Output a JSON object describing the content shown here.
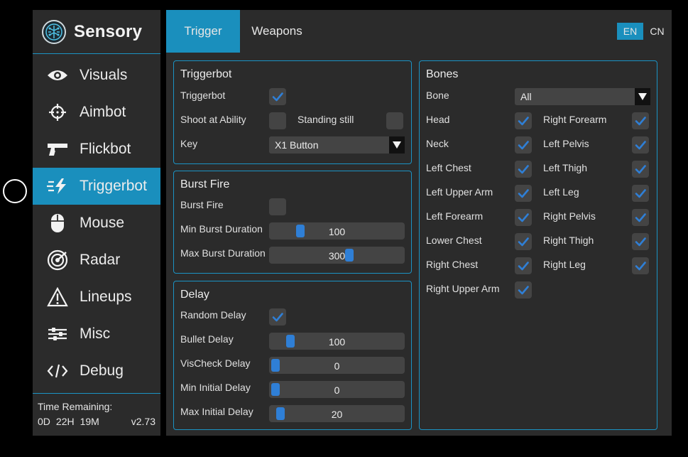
{
  "app": {
    "name": "Sensory"
  },
  "sidebar": {
    "items": [
      {
        "label": "Visuals",
        "icon": "eye-icon"
      },
      {
        "label": "Aimbot",
        "icon": "crosshair-icon"
      },
      {
        "label": "Flickbot",
        "icon": "gun-icon"
      },
      {
        "label": "Triggerbot",
        "icon": "lightning-icon",
        "active": true
      },
      {
        "label": "Mouse",
        "icon": "mouse-icon"
      },
      {
        "label": "Radar",
        "icon": "radar-icon"
      },
      {
        "label": "Lineups",
        "icon": "warning-triangle-icon"
      },
      {
        "label": "Misc",
        "icon": "sliders-icon"
      },
      {
        "label": "Debug",
        "icon": "code-icon"
      }
    ],
    "footer": {
      "time_label": "Time Remaining:",
      "days": "0D",
      "hours": "22H",
      "minutes": "19M",
      "version": "v2.73"
    }
  },
  "tabs": [
    {
      "label": "Trigger",
      "active": true
    },
    {
      "label": "Weapons",
      "active": false
    }
  ],
  "languages": {
    "en": "EN",
    "cn": "CN",
    "selected": "EN"
  },
  "triggerbot": {
    "title": "Triggerbot",
    "enabled_label": "Triggerbot",
    "enabled": true,
    "shoot_at_ability_label": "Shoot at Ability",
    "shoot_at_ability": false,
    "standing_still_label": "Standing still",
    "standing_still": false,
    "key_label": "Key",
    "key_value": "X1 Button"
  },
  "burst_fire": {
    "title": "Burst Fire",
    "enabled_label": "Burst Fire",
    "enabled": false,
    "min_label": "Min Burst Duration",
    "min_value": "100",
    "min_fraction": 0.2,
    "max_label": "Max Burst Duration",
    "max_value": "300",
    "max_fraction": 0.6
  },
  "delay": {
    "title": "Delay",
    "random_label": "Random Delay",
    "random": true,
    "bullet_label": "Bullet Delay",
    "bullet_value": "100",
    "bullet_fraction": 0.12,
    "vischeck_label": "VisCheck Delay",
    "vischeck_value": "0",
    "vischeck_fraction": 0.0,
    "min_initial_label": "Min Initial Delay",
    "min_initial_value": "0",
    "min_initial_fraction": 0.0,
    "max_initial_label": "Max Initial Delay",
    "max_initial_value": "20",
    "max_initial_fraction": 0.04
  },
  "bones": {
    "title": "Bones",
    "bone_label": "Bone",
    "bone_value": "All",
    "left_column": [
      {
        "label": "Head",
        "checked": true
      },
      {
        "label": "Neck",
        "checked": true
      },
      {
        "label": "Left Chest",
        "checked": true
      },
      {
        "label": "Left Upper Arm",
        "checked": true
      },
      {
        "label": "Left Forearm",
        "checked": true
      },
      {
        "label": "Lower Chest",
        "checked": true
      },
      {
        "label": "Right Chest",
        "checked": true
      },
      {
        "label": "Right Upper Arm",
        "checked": true
      }
    ],
    "right_column": [
      {
        "label": "Right Forearm",
        "checked": true
      },
      {
        "label": "Left Pelvis",
        "checked": true
      },
      {
        "label": "Left Thigh",
        "checked": true
      },
      {
        "label": "Left Leg",
        "checked": true
      },
      {
        "label": "Right Pelvis",
        "checked": true
      },
      {
        "label": "Right Thigh",
        "checked": true
      },
      {
        "label": "Right Leg",
        "checked": true
      }
    ]
  },
  "colors": {
    "accent": "#1a8fbd",
    "check": "#2f7fd6",
    "panel": "#2b2b2b",
    "control": "#444444"
  }
}
